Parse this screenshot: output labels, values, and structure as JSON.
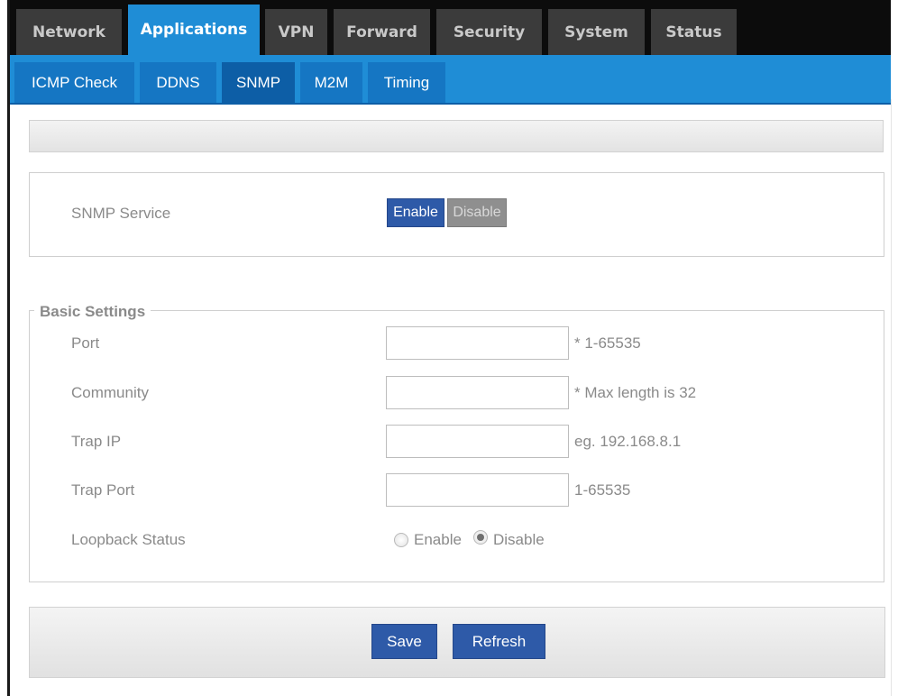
{
  "top_tabs": [
    "Network",
    "Applications",
    "VPN",
    "Forward",
    "Security",
    "System",
    "Status"
  ],
  "sub_tabs": [
    "ICMP Check",
    "DDNS",
    "SNMP",
    "M2M",
    "Timing"
  ],
  "service": {
    "label": "SNMP Service",
    "enable_label": "Enable",
    "disable_label": "Disable"
  },
  "basic_settings": {
    "legend": "Basic Settings",
    "port": {
      "label": "Port",
      "value": "",
      "hint": "* 1-65535"
    },
    "community": {
      "label": "Community",
      "value": "",
      "hint": "* Max length is 32"
    },
    "trap_ip": {
      "label": "Trap IP",
      "value": "",
      "hint": "eg. 192.168.8.1"
    },
    "trap_port": {
      "label": "Trap Port",
      "value": "",
      "hint": "1-65535"
    },
    "loopback": {
      "label": "Loopback Status",
      "options": [
        "Enable",
        "Disable"
      ],
      "selected": "Disable"
    }
  },
  "actions": {
    "save_label": "Save",
    "refresh_label": "Refresh"
  },
  "colors": {
    "nav_bg": "#0c0c0c",
    "tab_bg": "#3b3b3b",
    "accent": "#1f8dd6",
    "subtab_bg": "#1576c3",
    "button_blue": "#2e5aa8",
    "button_gray": "#8f8f8f"
  }
}
